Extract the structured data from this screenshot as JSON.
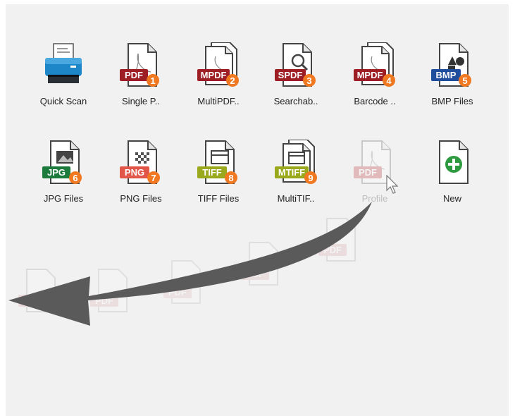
{
  "profiles": [
    {
      "label": "Quick Scan",
      "icon": "scanner-icon"
    },
    {
      "label": "Single P..",
      "icon": "pdf-file-icon",
      "badge": "PDF",
      "number": "1",
      "color": "#9e1e25"
    },
    {
      "label": "MultiPDF..",
      "icon": "multi-pdf-file-icon",
      "badge": "MPDF",
      "number": "2",
      "color": "#9e1e25"
    },
    {
      "label": "Searchab..",
      "icon": "searchable-pdf-file-icon",
      "badge": "SPDF",
      "number": "3",
      "color": "#9e1e25"
    },
    {
      "label": "Barcode ..",
      "icon": "barcode-pdf-file-icon",
      "badge": "MPDF",
      "number": "4",
      "color": "#9e1e25"
    },
    {
      "label": "BMP Files",
      "icon": "bmp-file-icon",
      "badge": "BMP",
      "number": "5",
      "color": "#1f4e9c"
    },
    {
      "label": "JPG Files",
      "icon": "jpg-file-icon",
      "badge": "JPG",
      "number": "6",
      "color": "#1c7a3c"
    },
    {
      "label": "PNG Files",
      "icon": "png-file-icon",
      "badge": "PNG",
      "number": "7",
      "color": "#e2564a"
    },
    {
      "label": "TIFF Files",
      "icon": "tiff-file-icon",
      "badge": "TIFF",
      "number": "8",
      "color": "#9aa81b"
    },
    {
      "label": "MultiTIF..",
      "icon": "multi-tiff-file-icon",
      "badge": "MTIFF",
      "number": "9",
      "color": "#9aa81b"
    },
    {
      "label": "Profile",
      "icon": "pdf-file-icon",
      "badge": "PDF",
      "state": "dragging"
    },
    {
      "label": "New",
      "icon": "add-profile-icon",
      "color": "#2e9a3f"
    }
  ],
  "drag_trail_badge": "PDF",
  "colors": {
    "number_badge": "#f07820",
    "scanner_blue": "#1d86c9",
    "arrow": "#555555"
  }
}
